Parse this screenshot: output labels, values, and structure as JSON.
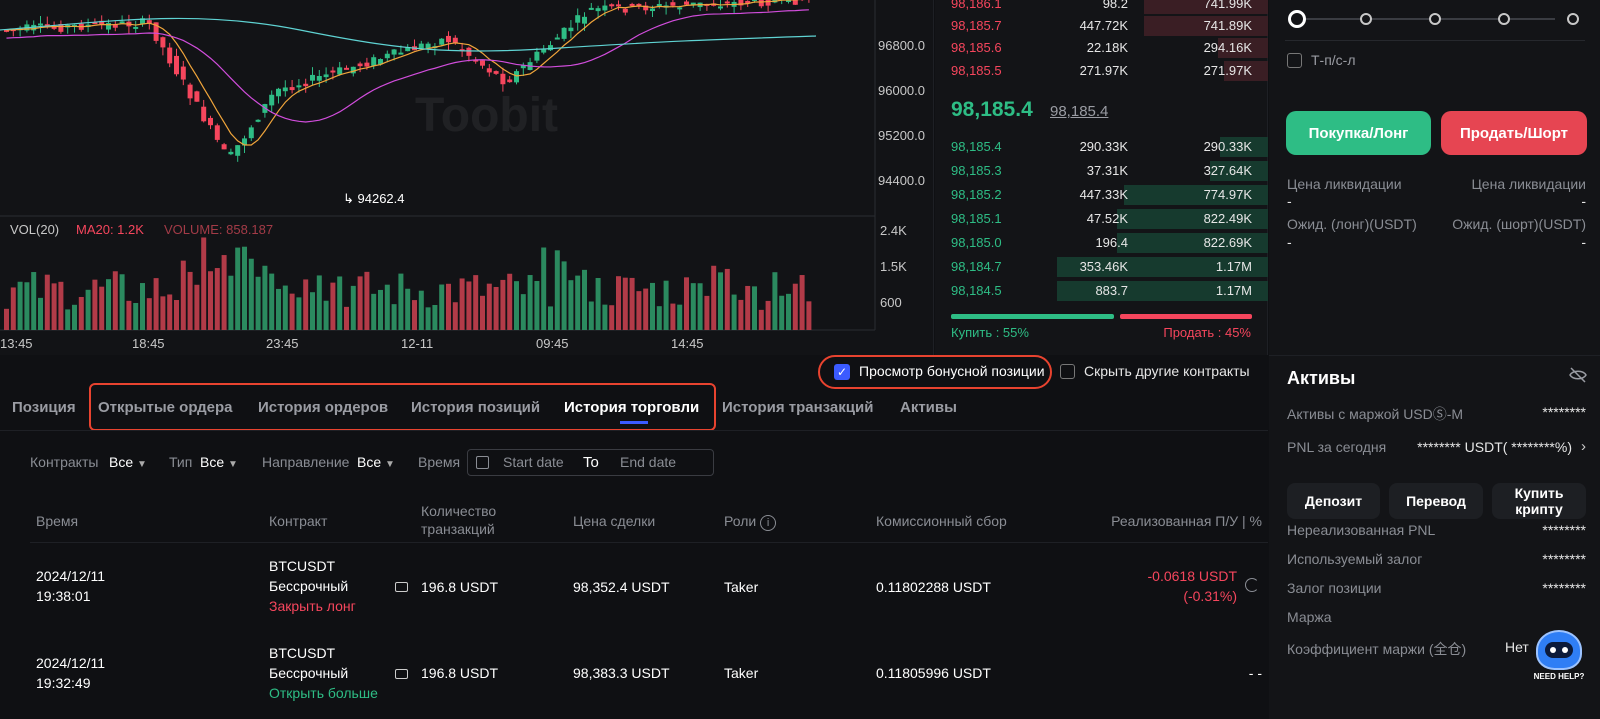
{
  "chart": {
    "price_labels": [
      "96800.0",
      "96000.0",
      "95200.0",
      "94400.0"
    ],
    "low_marker": "94262.4",
    "watermark": "Toobit",
    "volume_indicator": {
      "name": "VOL(20)",
      "ma": "MA20: 1.2K",
      "volume": "VOLUME: 858.187"
    },
    "volume_labels": [
      "2.4K",
      "1.5K",
      "600"
    ],
    "time_labels": [
      "13:45",
      "18:45",
      "23:45",
      "12-11",
      "09:45",
      "14:45"
    ]
  },
  "orderbook": {
    "asks": [
      {
        "price": "98,186.1",
        "qty": "98.2",
        "total": "741.99K"
      },
      {
        "price": "98,185.7",
        "qty": "447.72K",
        "total": "741.89K"
      },
      {
        "price": "98,185.6",
        "qty": "22.18K",
        "total": "294.16K"
      },
      {
        "price": "98,185.5",
        "qty": "271.97K",
        "total": "271.97K"
      }
    ],
    "last_price": "98,185.4",
    "mark_price": "98,185.4",
    "bids": [
      {
        "price": "98,185.4",
        "qty": "290.33K",
        "total": "290.33K"
      },
      {
        "price": "98,185.3",
        "qty": "37.31K",
        "total": "327.64K"
      },
      {
        "price": "98,185.2",
        "qty": "447.33K",
        "total": "774.97K"
      },
      {
        "price": "98,185.1",
        "qty": "47.52K",
        "total": "822.49K"
      },
      {
        "price": "98,185.0",
        "qty": "196.4",
        "total": "822.69K"
      },
      {
        "price": "98,184.7",
        "qty": "353.46K",
        "total": "1.17M"
      },
      {
        "price": "98,184.5",
        "qty": "883.7",
        "total": "1.17M"
      }
    ],
    "buy_label": "Купить :  55%",
    "sell_label": "Продать :  45%",
    "buy_ratio": 0.55
  },
  "trade": {
    "tpsl_label": "Т-п/с-л",
    "long_button": "Покупка/Лонг",
    "short_button": "Продать/Шорт",
    "liq_long_label": "Цена ликвидации",
    "liq_short_label": "Цена ликвидации",
    "liq_long_val": "-",
    "liq_short_val": "-",
    "exp_long_label": "Ожид. (лонг)(USDT)",
    "exp_short_label": "Ожид. (шорт)(USDT)",
    "exp_long_val": "-",
    "exp_short_val": "-"
  },
  "bottom": {
    "bonus_checkbox": "Просмотр бонусной позиции",
    "hide_checkbox": "Скрыть другие контракты",
    "tabs": [
      "Позиция",
      "Открытые ордера",
      "История ордеров",
      "История позиций",
      "История торговли",
      "История транзакций",
      "Активы"
    ],
    "filters": {
      "contracts_label": "Контракты",
      "contracts_val": "Все",
      "type_label": "Тип",
      "type_val": "Все",
      "direction_label": "Направление",
      "direction_val": "Все",
      "time_label": "Время",
      "start_placeholder": "Start date",
      "to_label": "To",
      "end_placeholder": "End date"
    },
    "headers": {
      "time": "Время",
      "contract": "Контракт",
      "qty_line1": "Количество",
      "qty_line2": "транзакций",
      "price": "Цена сделки",
      "role": "Роли",
      "fee": "Комиссионный сбор",
      "pnl": "Реализованная П/У | %"
    },
    "rows": [
      {
        "date": "2024/12/11",
        "time": "19:38:01",
        "symbol": "BTCUSDT",
        "kind": "Бессрочный",
        "action": "Закрыть лонг",
        "qty": "196.8 USDT",
        "price": "98,352.4 USDT",
        "role": "Taker",
        "fee": "0.11802288 USDT",
        "pnl1": "-0.0618 USDT",
        "pnl2": "(-0.31%)"
      },
      {
        "date": "2024/12/11",
        "time": "19:32:49",
        "symbol": "BTCUSDT",
        "kind": "Бессрочный",
        "action": "Открыть больше",
        "qty": "196.8 USDT",
        "price": "98,383.3 USDT",
        "role": "Taker",
        "fee": "0.11805996 USDT",
        "pnl1": "- -",
        "pnl2": ""
      }
    ]
  },
  "assets": {
    "title": "Активы",
    "margin_label": "Активы с маржой USDⓈ-M",
    "margin_val": "********",
    "pnl_today_label": "PNL за сегодня",
    "pnl_today_val": "******** USDT( ********%)",
    "deposit": "Депозит",
    "transfer": "Перевод",
    "buy_crypto": "Купить крипту",
    "unrealized_label": "Нереализованная PNL",
    "unrealized_val": "********",
    "used_margin_label": "Используемый залог",
    "used_margin_val": "********",
    "position_margin_label": "Залог позиции",
    "position_margin_val": "********",
    "margin_section": "Маржа",
    "margin_ratio_label": "Коэффициент маржи (全仓)",
    "margin_ratio_val": "Нет",
    "help_badge": "NEED HELP?"
  },
  "colors": {
    "green": "#2ebd85",
    "red": "#f6465d",
    "accent": "#3b5bff",
    "highlight": "#e8432f"
  }
}
